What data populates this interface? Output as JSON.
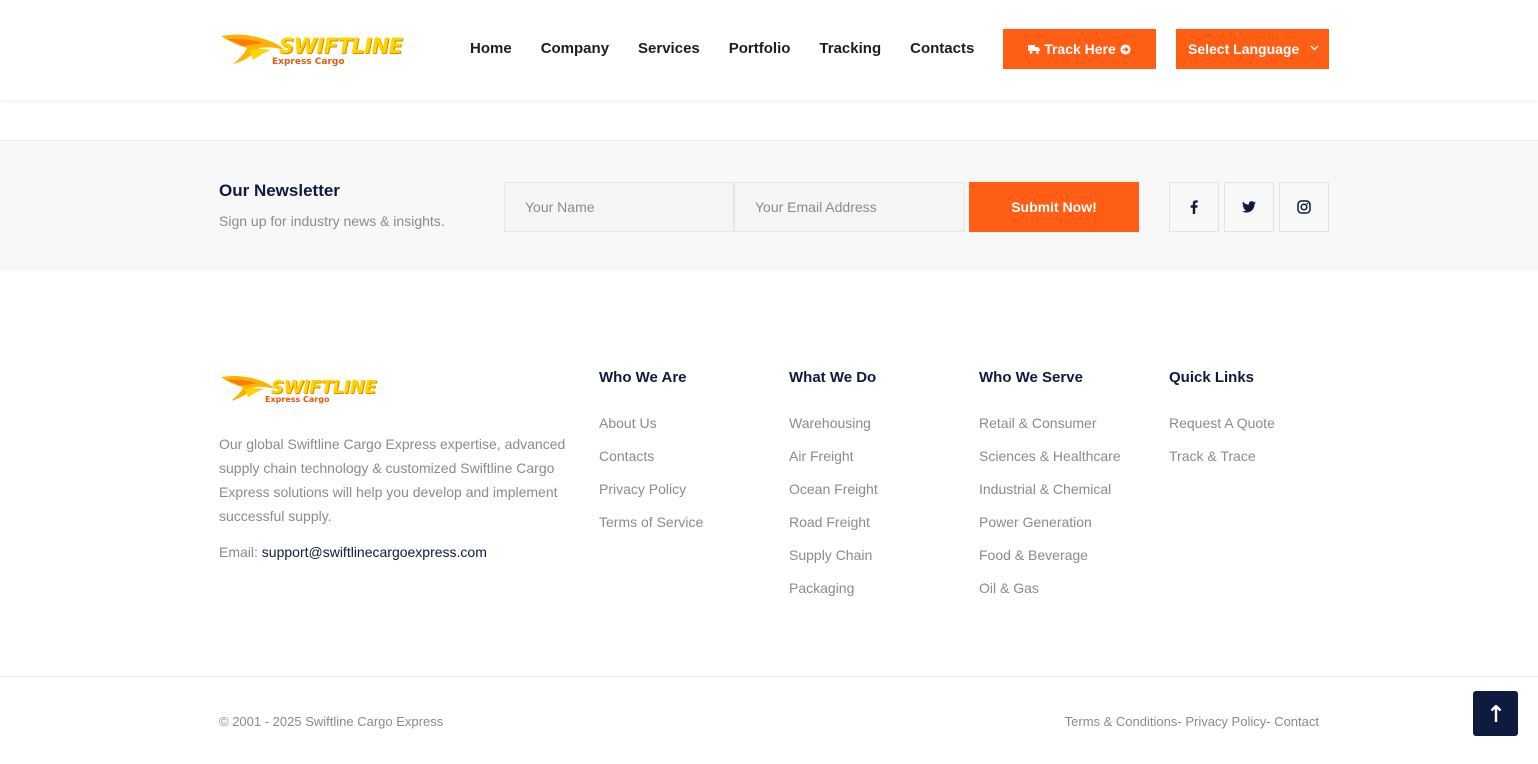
{
  "header": {
    "logo": {
      "main": "SWIFTLINE",
      "sub": "Express Cargo"
    },
    "nav": [
      "Home",
      "Company",
      "Services",
      "Portfolio",
      "Tracking",
      "Contacts"
    ],
    "track_button": "Track Here",
    "language_button": "Select Language"
  },
  "newsletter": {
    "title": "Our Newsletter",
    "subtitle": "Sign up for industry news & insights.",
    "name_placeholder": "Your Name",
    "email_placeholder": "Your Email Address",
    "submit_label": "Submit Now!",
    "social_icons": [
      "facebook-icon",
      "twitter-icon",
      "instagram-icon"
    ]
  },
  "footer": {
    "logo": {
      "main": "SWIFTLINE",
      "sub": "Express Cargo"
    },
    "about": "Our global Swiftline Cargo Express expertise, advanced supply chain technology & customized Swiftline Cargo Express solutions will help you develop and implement successful supply.",
    "email_label": "Email:",
    "email": "support@swiftlinecargoexpress.com",
    "columns": [
      {
        "title": "Who We Are",
        "links": [
          "About Us",
          "Contacts",
          "Privacy Policy",
          "Terms of Service"
        ]
      },
      {
        "title": "What We Do",
        "links": [
          "Warehousing",
          "Air Freight",
          "Ocean Freight",
          "Road Freight",
          "Supply Chain",
          "Packaging"
        ]
      },
      {
        "title": "Who We Serve",
        "links": [
          "Retail & Consumer",
          "Sciences & Healthcare",
          "Industrial & Chemical",
          "Power Generation",
          "Food & Beverage",
          "Oil & Gas"
        ]
      },
      {
        "title": "Quick Links",
        "links": [
          "Request A Quote",
          "Track & Trace"
        ]
      }
    ],
    "copyright": "© 2001 - 2025 Swiftline Cargo Express",
    "legal": [
      "Terms & Conditions",
      "Privacy Policy",
      "Contact"
    ]
  },
  "colors": {
    "accent": "#ff5e14",
    "navy": "#0e1a3e",
    "muted": "#8b8b8b"
  }
}
